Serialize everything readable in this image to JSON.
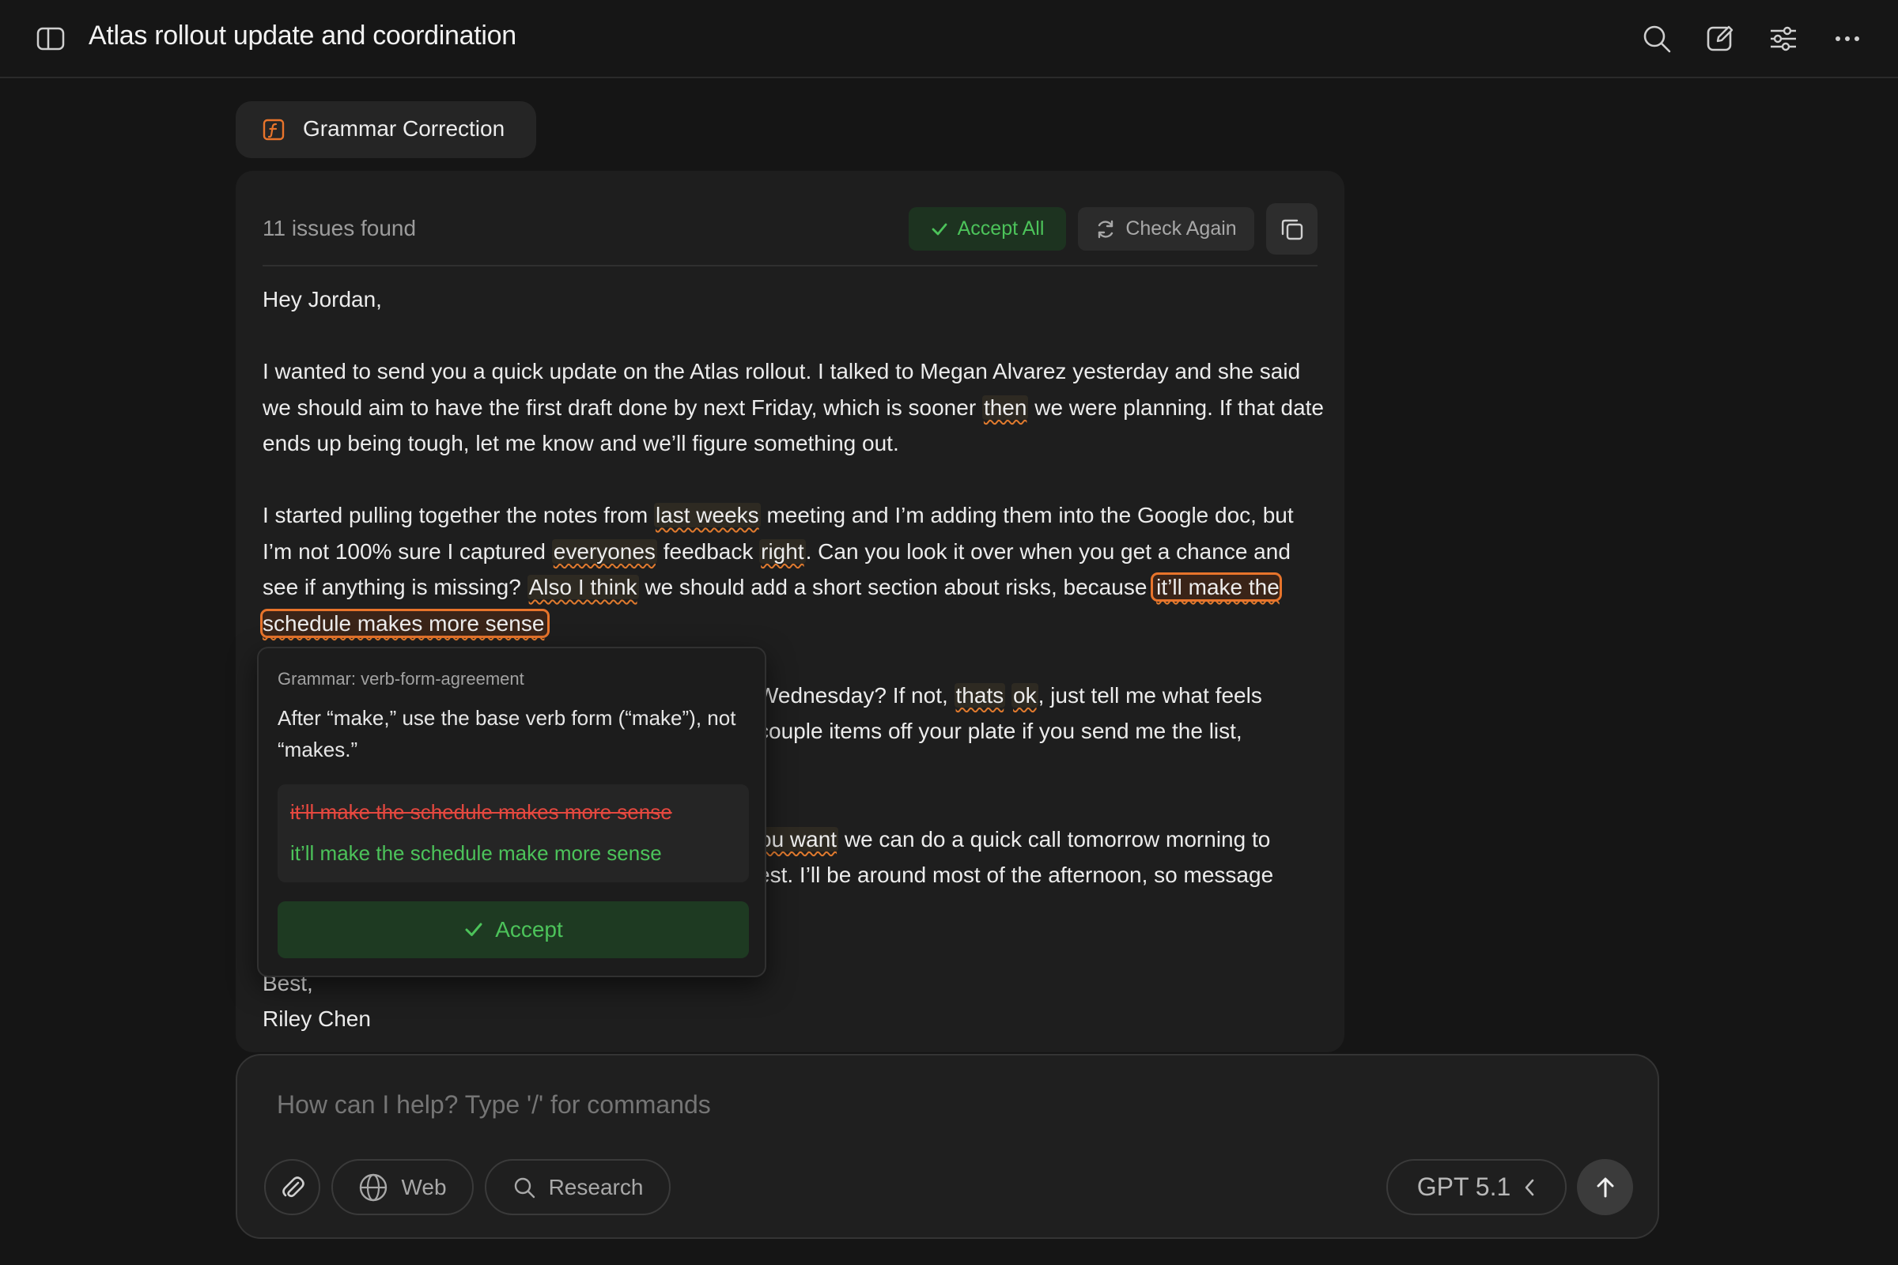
{
  "header": {
    "title": "Atlas rollout update and coordination",
    "icons": [
      "sidebar-toggle-icon",
      "search-icon",
      "compose-icon",
      "sliders-icon",
      "more-icon"
    ]
  },
  "tool_chip": {
    "label": "Grammar Correction",
    "icon": "function-icon",
    "accent": "#e8742b"
  },
  "card": {
    "issues_text": "11 issues found",
    "accept_all_label": "Accept All",
    "check_again_label": "Check Again",
    "copy_icon": "copy-icon"
  },
  "email": {
    "greeting": "Hey Jordan,",
    "p1": {
      "a": "I wanted to send you a quick update on the Atlas rollout. I talked to Megan Alvarez yesterday and she said we should aim to have the first draft done by next Friday, which is sooner ",
      "err1": "then",
      "b": " we were planning. If that date ends up being tough, let me know and we’ll figure something out."
    },
    "p2": {
      "a": "I started pulling together the notes from ",
      "err1": "last weeks",
      "b": " meeting and I’m adding them into the Google doc, but I’m not 100% sure I captured ",
      "err2": "everyones",
      "c": " feedback ",
      "err3": "right",
      "d": ". Can you look it over when you get a chance and see if anything is missing? ",
      "err4": "Also I think",
      "e": " we should add a short section about risks, because ",
      "active": "it’ll make the schedule makes more sense"
    },
    "p3": {
      "a": "Wednesday? If not, ",
      "err1": "thats",
      "sp": " ",
      "err2": "ok",
      "b": ", just tell me what feels",
      "line2": "couple items off your plate if you send me the list,"
    },
    "p4": {
      "err1": "ou want",
      "a": " we can do a quick call tomorrow morning to",
      "line2": "est. I’ll be around most of the afternoon, so message"
    },
    "closing": "Best,",
    "signature": "Riley Chen"
  },
  "popover": {
    "rule": "Grammar: verb-form-agreement",
    "description": "After “make,” use the base verb form (“make”), not “makes.”",
    "original": "it’ll make the schedule makes more sense",
    "suggestion": "it’ll make the schedule make more sense",
    "accept_label": "Accept"
  },
  "composer": {
    "placeholder": "How can I help? Type '/' for commands",
    "web_label": "Web",
    "research_label": "Research",
    "model_label": "GPT 5.1"
  },
  "colors": {
    "background": "#151515",
    "accent_orange": "#e8742b",
    "success_green": "#4cc35a",
    "error_red": "#e5483f"
  }
}
